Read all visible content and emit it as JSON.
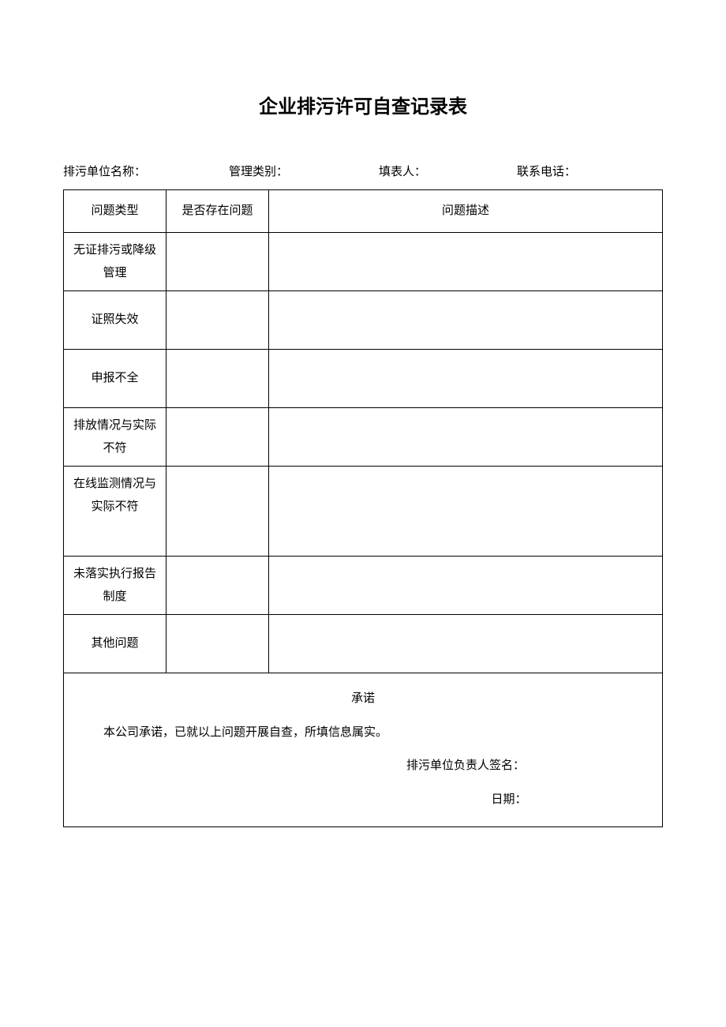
{
  "title": "企业排污许可自查记录表",
  "info": {
    "unit_name_label": "排污单位名称：",
    "category_label": "管理类别：",
    "filler_label": "填表人：",
    "phone_label": "联系电话："
  },
  "headers": {
    "type": "问题类型",
    "exist": "是否存在问题",
    "desc": "问题描述"
  },
  "rows": [
    {
      "type": "无证排污或降级管理",
      "exist": "",
      "desc": ""
    },
    {
      "type": "证照失效",
      "exist": "",
      "desc": ""
    },
    {
      "type": "申报不全",
      "exist": "",
      "desc": ""
    },
    {
      "type": "排放情况与实际不符",
      "exist": "",
      "desc": ""
    },
    {
      "type": "在线监测情况与实际不符",
      "exist": "",
      "desc": ""
    },
    {
      "type": "未落实执行报告制度",
      "exist": "",
      "desc": ""
    },
    {
      "type": "其他问题",
      "exist": "",
      "desc": ""
    }
  ],
  "promise": {
    "title": "承诺",
    "body": "本公司承诺，已就以上问题开展自查，所填信息属实。",
    "sign": "排污单位负责人签名：",
    "date": "日期："
  }
}
